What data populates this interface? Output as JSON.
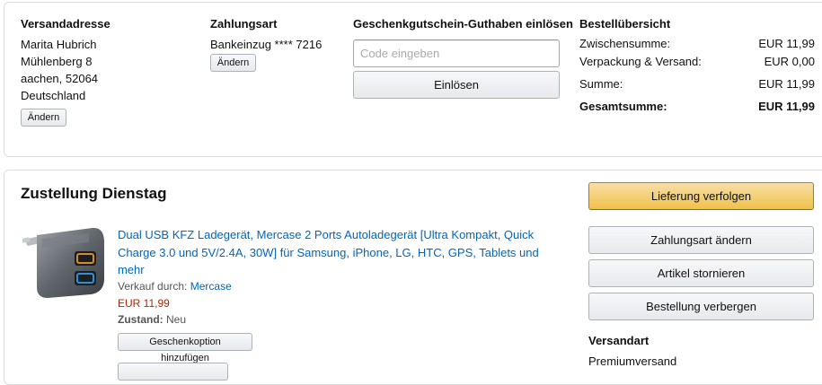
{
  "address": {
    "heading": "Versandadresse",
    "name": "Marita Hubrich",
    "street": "Mühlenberg 8",
    "city": "aachen, 52064",
    "country": "Deutschland",
    "change_label": "Ändern"
  },
  "payment": {
    "heading": "Zahlungsart",
    "method": "Bankeinzug **** 7216",
    "change_label": "Ändern"
  },
  "voucher": {
    "heading": "Geschenkgutschein-Guthaben einlösen",
    "placeholder": "Code eingeben",
    "redeem_label": "Einlösen"
  },
  "summary": {
    "heading": "Bestellübersicht",
    "rows": [
      {
        "label": "Zwischensumme:",
        "value": "EUR 11,99"
      },
      {
        "label": "Verpackung & Versand:",
        "value": "EUR 0,00"
      },
      {
        "label": "Summe:",
        "value": "EUR 11,99"
      }
    ],
    "total_label": "Gesamtsumme:",
    "total_value": "EUR 11,99"
  },
  "delivery": {
    "heading": "Zustellung Dienstag",
    "product": {
      "title": "Dual USB KFZ Ladegerät, Mercase 2 Ports Autoladegerät [Ultra Kompakt, Quick Charge 3.0 und 5V/2.4A, 30W] für Samsung, iPhone, LG, HTC, GPS, Tablets und mehr",
      "seller_label": "Verkauf durch:",
      "seller_name": "Mercase",
      "price": "EUR 11,99",
      "condition_label": "Zustand:",
      "condition_value": "Neu",
      "gift_button": "Geschenkoption hinzufügen"
    },
    "actions": {
      "track": "Lieferung verfolgen",
      "change_payment": "Zahlungsart ändern",
      "cancel": "Artikel stornieren",
      "hide": "Bestellung verbergen"
    },
    "shipping_heading": "Versandart",
    "shipping_value": "Premiumversand"
  },
  "colors": {
    "link": "#0066c0",
    "price": "#b12704",
    "primary_button": "#f0c14b"
  }
}
